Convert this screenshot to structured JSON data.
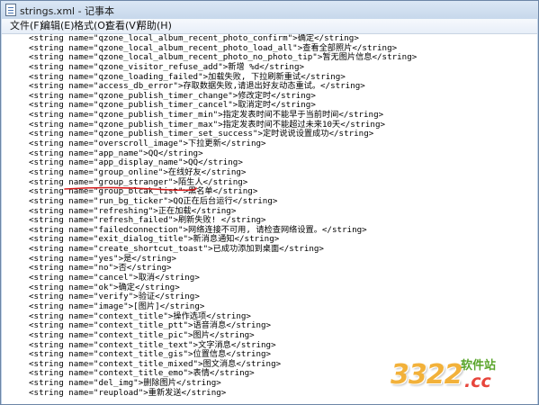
{
  "window": {
    "title": "strings.xml - 记事本",
    "icon": "notepad-icon"
  },
  "menu": {
    "items": [
      "文件(F)",
      "编辑(E)",
      "格式(O)",
      "查看(V)",
      "帮助(H)"
    ]
  },
  "editor": {
    "lines": [
      "<string name=\"qzone_local_album_recent_photo_confirm\">确定</string>",
      "<string name=\"qzone_local_album_recent_photo_load_all\">查看全部照片</string>",
      "<string name=\"qzone_local_album_recent_photo_no_photo_tip\">暂无图片信息</string>",
      "<string name=\"qzone_visitor_refuse_add\">新增 %d</string>",
      "<string name=\"qzone_loading_failed\">加载失败, 下拉刷新重试</string>",
      "<string name=\"access_db_error\">存取数据失败,请退出好友动态重试。</string>",
      "<string name=\"qzone_publish_timer_change\">修改定时</string>",
      "<string name=\"qzone_publish_timer_cancel\">取消定时</string>",
      "<string name=\"qzone_publish_timer_min\">指定发表时间不能早于当前时间</string>",
      "<string name=\"qzone_publish_timer_max\">指定发表时间不能超过未来10天</string>",
      "<string name=\"qzone_publish_timer_set_success\">定时说说设置成功</string>",
      "<string name=\"overscroll_image\">下拉更新</string>",
      "<string name=\"app_name\">QQ</string>",
      "<string name=\"app_display_name\">QQ</string>",
      "<string name=\"group_online\">在线好友</string>",
      "<string name=\"group_stranger\">陌生人</string>",
      "<string name=\"group_blcak_list\">黑名单</string>",
      "<string name=\"run_bg_ticker\">QQ正在后台运行</string>",
      "<string name=\"refreshing\">正在加载</string>",
      "<string name=\"refresh_failed\">刷新失败! </string>",
      "<string name=\"failedconnection\">网络连接不可用, 请检查网络设置。</string>",
      "<string name=\"exit_dialog_title\">新消息通知</string>",
      "<string name=\"create_shortcut_toast\">已成功添加到桌面</string>",
      "<string name=\"yes\">是</string>",
      "<string name=\"no\">否</string>",
      "<string name=\"cancel\">取消</string>",
      "<string name=\"ok\">确定</string>",
      "<string name=\"verify\">验证</string>",
      "<string name=\"image\">[图片]</string>",
      "<string name=\"context_title\">操作选项</string>",
      "<string name=\"context_title_ptt\">语音消息</string>",
      "<string name=\"context_title_pic\">图片</string>",
      "<string name=\"context_title_text\">文字消息</string>",
      "<string name=\"context_title_gis\">位置信息</string>",
      "<string name=\"context_title_mixed\">图文消息</string>",
      "<string name=\"context_title_emo\">表情</string>",
      "<string name=\"del_img\">删除图片</string>",
      "<string name=\"reupload\">重新发送</string>"
    ],
    "annotation_color": "#d81e1e"
  },
  "watermark": {
    "number": "3322",
    "site": "软件站",
    "tld": ".cc"
  }
}
